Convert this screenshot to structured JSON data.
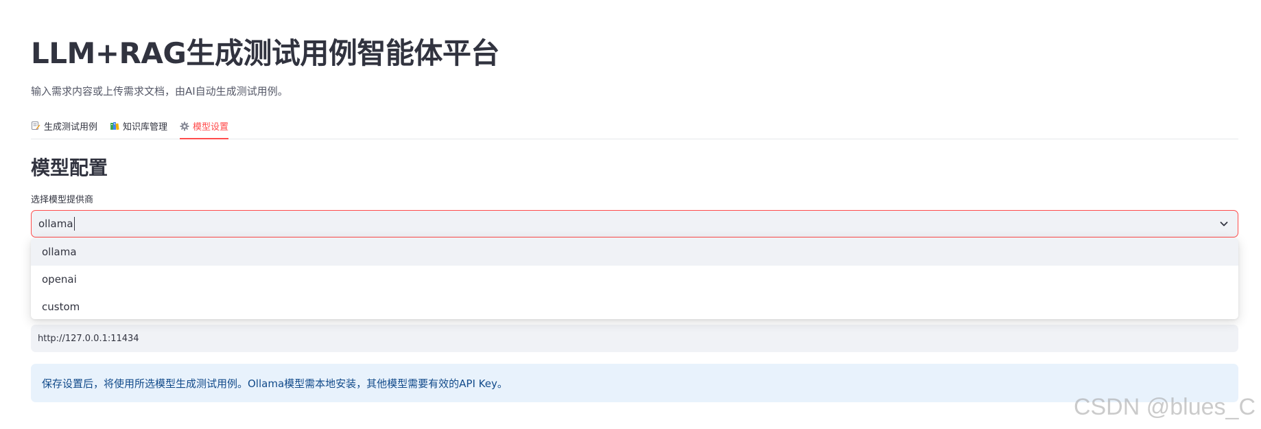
{
  "header": {
    "title": "LLM+RAG生成测试用例智能体平台",
    "subtitle": "输入需求内容或上传需求文档，由AI自动生成测试用例。"
  },
  "tabs": [
    {
      "label": "生成测试用例",
      "icon": "memo-icon",
      "active": false
    },
    {
      "label": "知识库管理",
      "icon": "books-icon",
      "active": false
    },
    {
      "label": "模型设置",
      "icon": "gear-icon",
      "active": true
    }
  ],
  "section": {
    "title": "模型配置"
  },
  "provider_select": {
    "label": "选择模型提供商",
    "value": "ollama",
    "options": [
      "ollama",
      "openai",
      "custom"
    ],
    "highlighted": "ollama"
  },
  "base_url_field": {
    "value": "http://127.0.0.1:11434"
  },
  "info": {
    "text": "保存设置后，将使用所选模型生成测试用例。Ollama模型需本地安装，其他模型需要有效的API Key。"
  },
  "watermark": {
    "text": "CSDN @blues_C"
  },
  "colors": {
    "accent": "#ff4b4b",
    "input_bg": "#f0f2f6",
    "info_bg": "#e8f2fc",
    "info_text": "#114a8a",
    "text": "#31333f"
  }
}
